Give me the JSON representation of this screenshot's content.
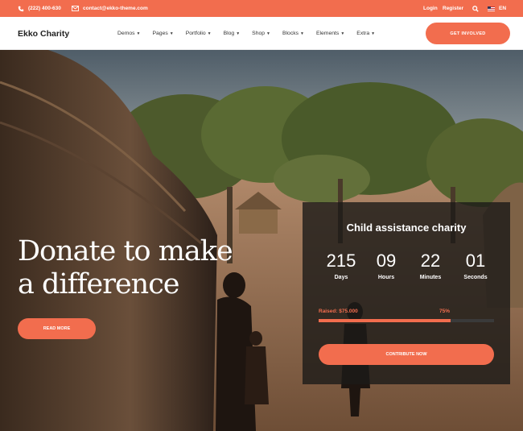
{
  "topbar": {
    "phone": "(222) 400-630",
    "email": "contact@ekko-theme.com",
    "login": "Login",
    "register": "Register",
    "language": "EN"
  },
  "nav": {
    "brand": "Ekko Charity",
    "menu": [
      "Demos",
      "Pages",
      "Portfolio",
      "Blog",
      "Shop",
      "Blocks",
      "Elements",
      "Extra"
    ],
    "cta": "GET INVOLVED"
  },
  "hero": {
    "headline_line1": "Donate to make",
    "headline_line2": "a difference",
    "read_more": "READ MORE"
  },
  "campaign": {
    "title": "Child assistance charity",
    "countdown": [
      {
        "value": "215",
        "label": "Days"
      },
      {
        "value": "09",
        "label": "Hours"
      },
      {
        "value": "22",
        "label": "Minutes"
      },
      {
        "value": "01",
        "label": "Seconds"
      }
    ],
    "raised": "Raised: $75.000",
    "percent": "75%",
    "progress_fraction": 0.75,
    "button": "CONTRIBUTE NOW"
  },
  "colors": {
    "accent": "#f26d4e",
    "card_bg": "#1c1a18"
  },
  "icons": {
    "phone": "phone-icon",
    "email": "envelope-icon",
    "search": "search-icon",
    "flag": "us-flag-icon",
    "caret": "chevron-down-icon"
  }
}
